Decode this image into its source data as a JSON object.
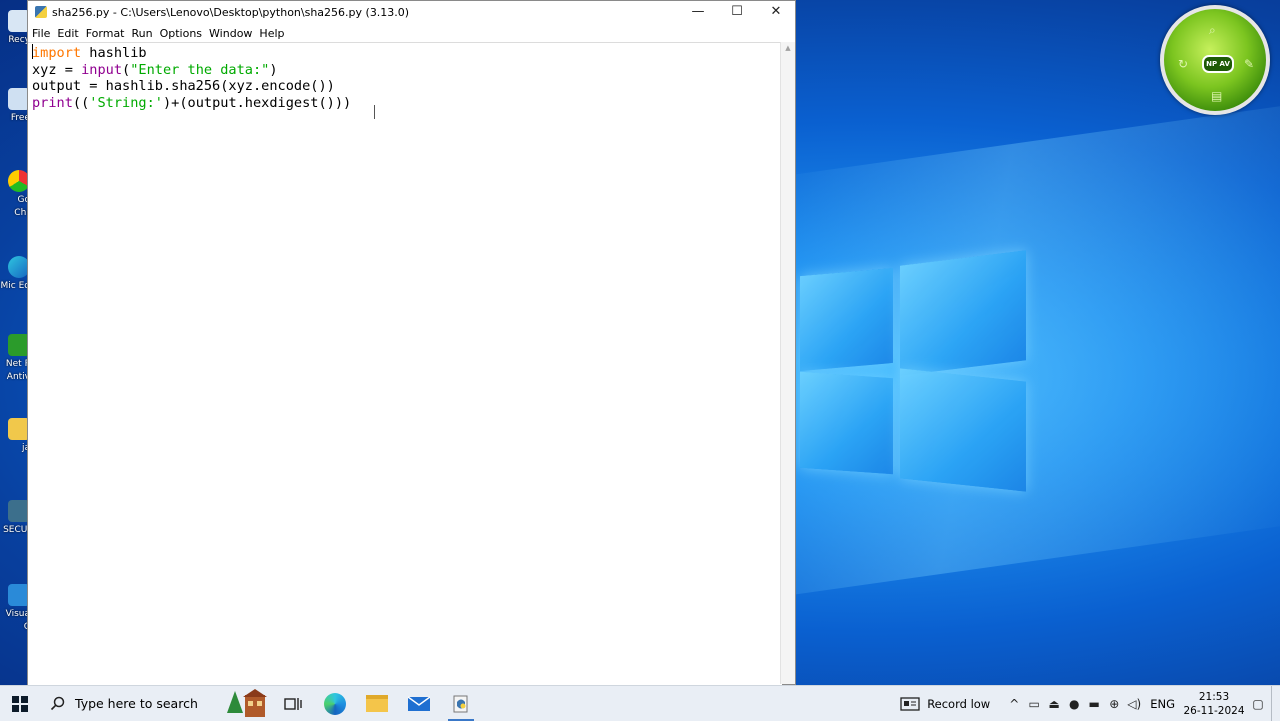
{
  "window": {
    "title": "sha256.py - C:\\Users\\Lenovo\\Desktop\\python\\sha256.py (3.13.0)",
    "minimize": "—",
    "maximize": "☐",
    "close": "✕"
  },
  "menu": [
    "File",
    "Edit",
    "Format",
    "Run",
    "Options",
    "Window",
    "Help"
  ],
  "code_lines": [
    [
      {
        "t": "import",
        "c": "kw"
      },
      {
        "t": " hashlib",
        "c": ""
      }
    ],
    [
      {
        "t": "xyz = ",
        "c": ""
      },
      {
        "t": "input",
        "c": "bi"
      },
      {
        "t": "(",
        "c": ""
      },
      {
        "t": "\"Enter the data:\"",
        "c": "st"
      },
      {
        "t": ")",
        "c": ""
      }
    ],
    [
      {
        "t": "output = hashlib.sha256(xyz.encode())",
        "c": ""
      }
    ],
    [
      {
        "t": "print",
        "c": "bi"
      },
      {
        "t": "((",
        "c": ""
      },
      {
        "t": "'String:'",
        "c": "st"
      },
      {
        "t": ")+(output.hexdigest()))",
        "c": ""
      }
    ]
  ],
  "desktop_icons": [
    "Recy",
    "Free",
    "Go Chr",
    "Mic Ed",
    "Net P Antiv",
    "ja",
    "SECUI",
    "Visua C"
  ],
  "gadget": {
    "badge": "NP AV"
  },
  "taskbar": {
    "search_placeholder": "Type here to search",
    "record_label": "Record low",
    "language": "ENG",
    "time": "21:53",
    "date": "26-11-2024"
  },
  "colors": {
    "keyword": "#ff7700",
    "builtin": "#900090",
    "string": "#00aa00"
  }
}
